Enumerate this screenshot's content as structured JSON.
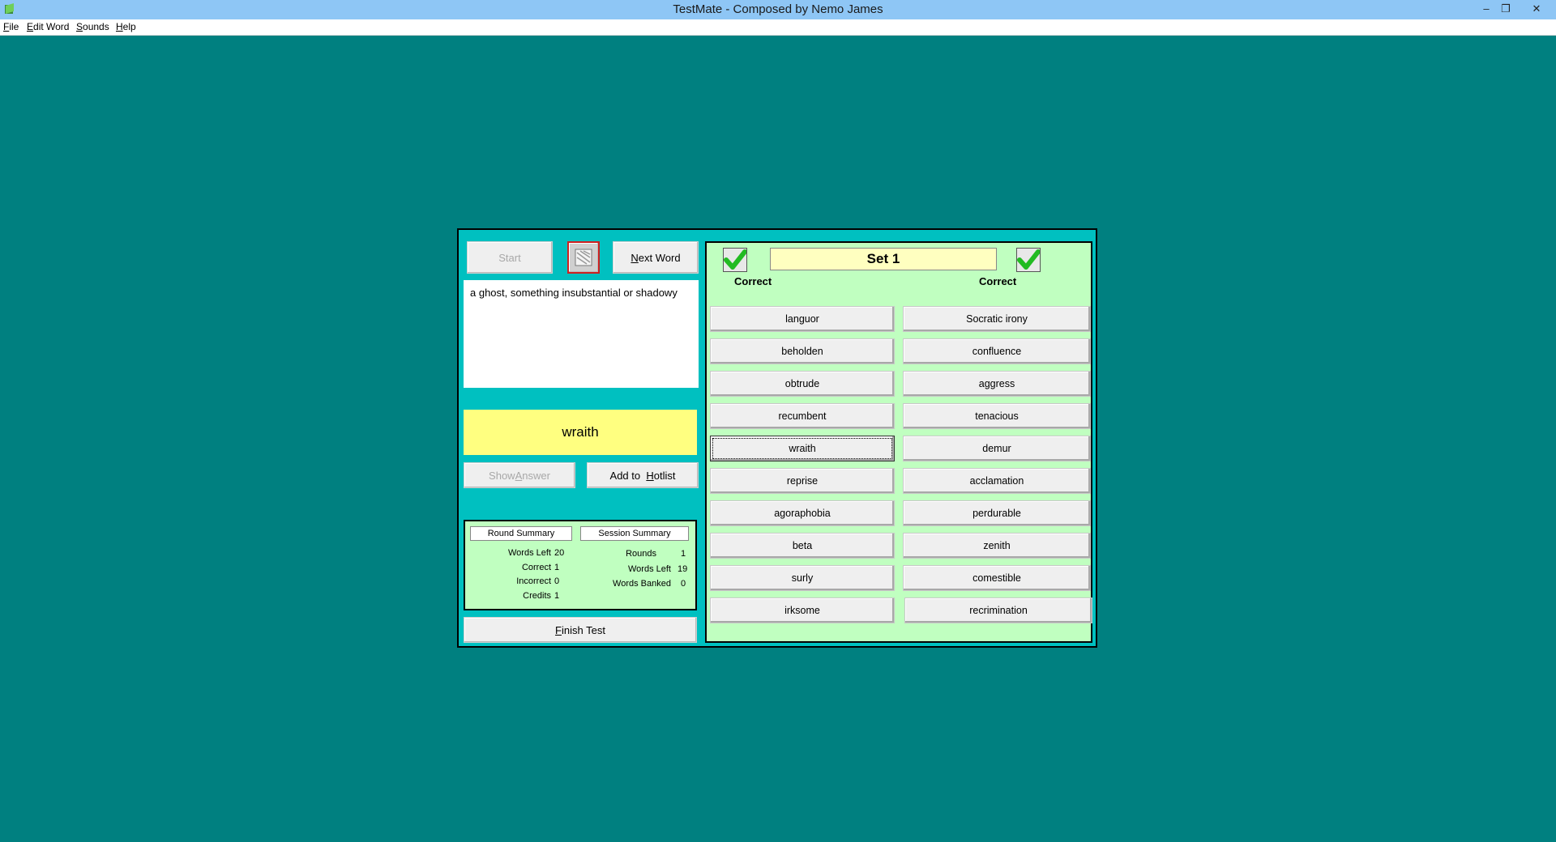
{
  "window": {
    "title": "TestMate - Composed by Nemo James",
    "minimize": "–",
    "restore": "❐",
    "close": "✕"
  },
  "menu": [
    {
      "pre": "",
      "acc": "F",
      "post": "ile"
    },
    {
      "pre": "",
      "acc": "E",
      "post": "dit Word"
    },
    {
      "pre": "",
      "acc": "S",
      "post": "ounds"
    },
    {
      "pre": "",
      "acc": "H",
      "post": "elp"
    }
  ],
  "controls": {
    "start_label": "Start",
    "next_word_pre": "",
    "next_word_acc": "N",
    "next_word_post": "ext Word",
    "show_answer_pre": "Show ",
    "show_answer_acc": "A",
    "show_answer_post": "nswer",
    "hotlist_pre": "Add to  ",
    "hotlist_acc": "H",
    "hotlist_post": "otlist",
    "finish_pre": "",
    "finish_acc": "F",
    "finish_post": "inish Test"
  },
  "definition": "a ghost, something insubstantial or shadowy",
  "answer": "wraith",
  "summary": {
    "round_tab": "Round Summary",
    "session_tab": "Session Summary",
    "round": [
      {
        "label": "Words Left",
        "value": "20"
      },
      {
        "label": "Correct",
        "value": "1"
      },
      {
        "label": "Incorrect",
        "value": "0"
      },
      {
        "label": "Credits",
        "value": "1"
      }
    ],
    "session": [
      {
        "label": "Rounds",
        "value": "1"
      },
      {
        "label": "Words Left",
        "value": "19"
      },
      {
        "label": "Words Banked",
        "value": "0"
      }
    ]
  },
  "set": {
    "title": "Set 1",
    "left_check_label": "Correct",
    "right_check_label": "Correct",
    "left_words": [
      "languor",
      "beholden",
      "obtrude",
      "recumbent",
      "wraith",
      "reprise",
      "agoraphobia",
      "beta",
      "surly",
      "irksome"
    ],
    "right_words": [
      "Socratic irony",
      "confluence",
      "aggress",
      "tenacious",
      "demur",
      "acclamation",
      "perdurable",
      "zenith",
      "comestible",
      "recrimination"
    ],
    "selected_word": "wraith"
  },
  "colors": {
    "desktop": "#008080",
    "frame": "#00c0c0",
    "panel": "#c0ffc0",
    "answer": "#ffff80",
    "check": "#22bb22"
  }
}
